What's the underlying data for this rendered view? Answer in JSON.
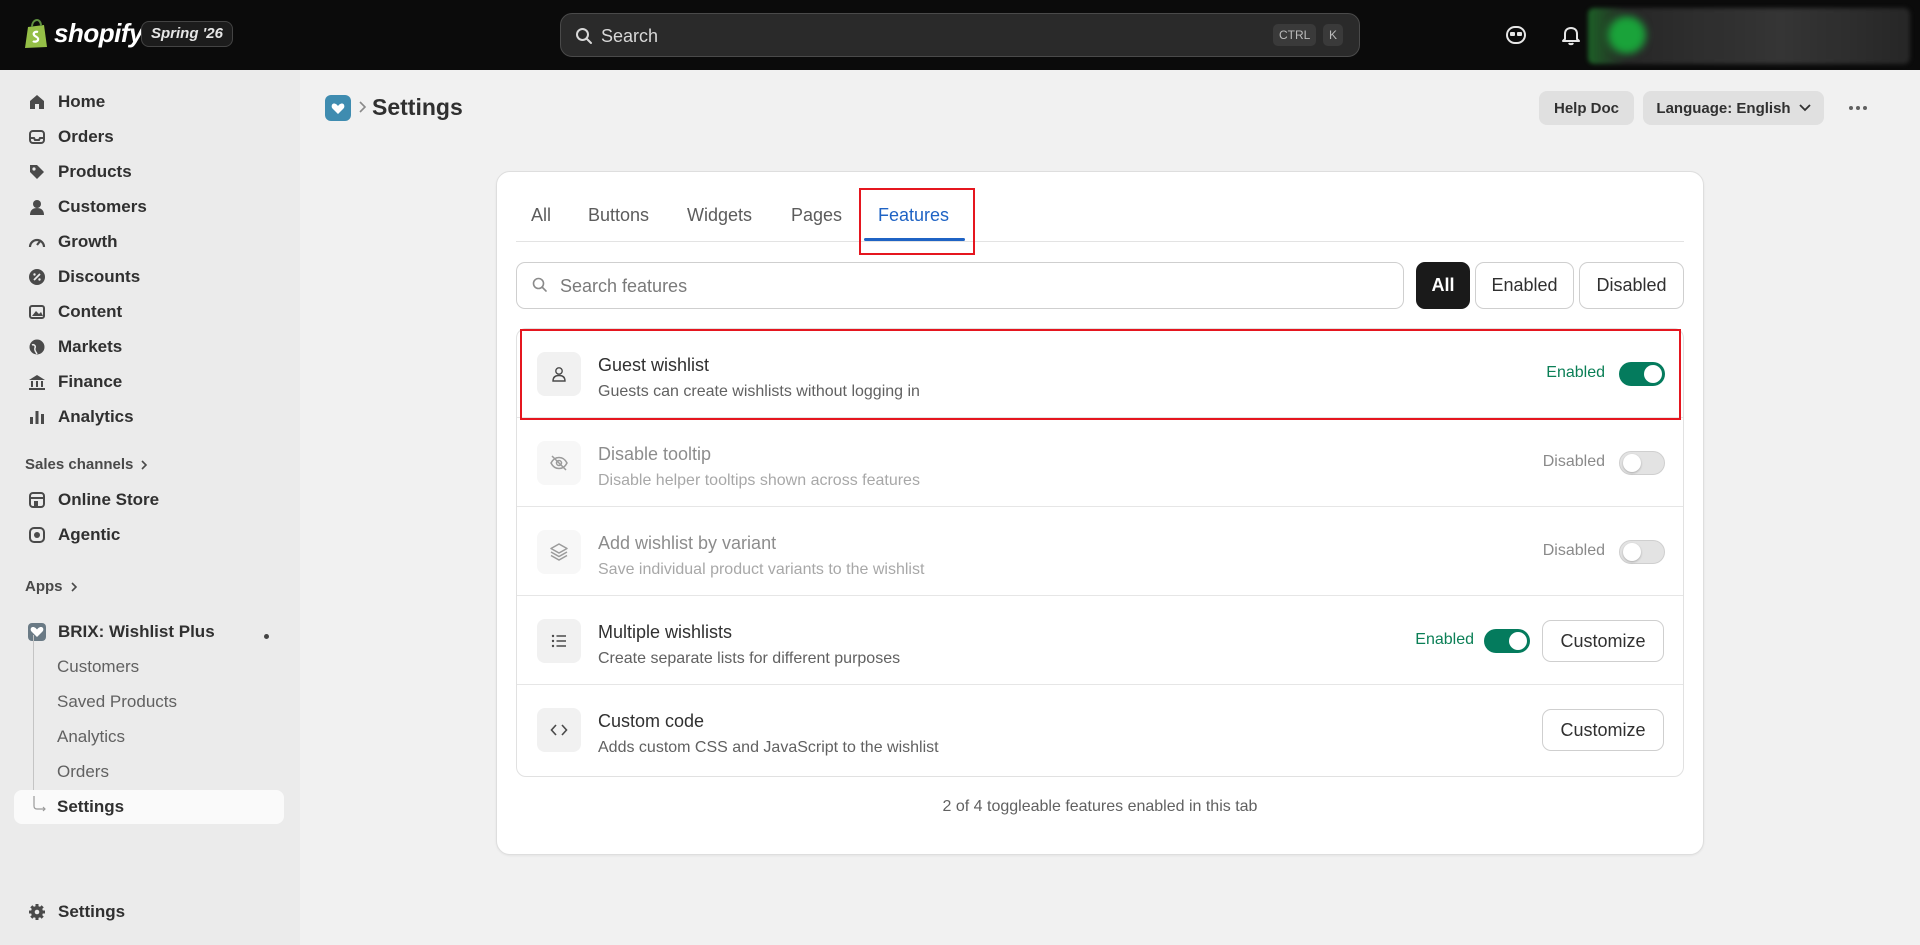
{
  "topbar": {
    "logo_text": "shopify",
    "edition_badge": "Spring '26",
    "search_placeholder": "Search",
    "shortcut_ctrl": "CTRL",
    "shortcut_key": "K"
  },
  "sidebar": {
    "items": [
      {
        "label": "Home",
        "icon": "home-icon"
      },
      {
        "label": "Orders",
        "icon": "orders-icon"
      },
      {
        "label": "Products",
        "icon": "tag-icon"
      },
      {
        "label": "Customers",
        "icon": "person-icon"
      },
      {
        "label": "Growth",
        "icon": "gauge-icon"
      },
      {
        "label": "Discounts",
        "icon": "discount-icon"
      },
      {
        "label": "Content",
        "icon": "image-icon"
      },
      {
        "label": "Markets",
        "icon": "globe-icon"
      },
      {
        "label": "Finance",
        "icon": "bank-icon"
      },
      {
        "label": "Analytics",
        "icon": "bar-chart-icon"
      }
    ],
    "sales_channels_label": "Sales channels",
    "channels": [
      {
        "label": "Online Store",
        "icon": "store-icon"
      },
      {
        "label": "Agentic",
        "icon": "agentic-icon"
      }
    ],
    "apps_label": "Apps",
    "app": {
      "label": "BRIX: Wishlist Plus",
      "icon": "wishlist-app-icon"
    },
    "app_subitems": [
      "Customers",
      "Saved Products",
      "Analytics",
      "Orders",
      "Settings"
    ],
    "bottom_settings": "Settings"
  },
  "header": {
    "title": "Settings",
    "help_doc": "Help Doc",
    "language": "Language: English"
  },
  "tabs": [
    "All",
    "Buttons",
    "Widgets",
    "Pages",
    "Features"
  ],
  "active_tab": "Features",
  "search": {
    "placeholder": "Search features"
  },
  "filters": [
    "All",
    "Enabled",
    "Disabled"
  ],
  "features": [
    {
      "title": "Guest wishlist",
      "desc": "Guests can create wishlists without logging in",
      "status": "Enabled",
      "enabled": true,
      "icon": "person-icon"
    },
    {
      "title": "Disable tooltip",
      "desc": "Disable helper tooltips shown across features",
      "status": "Disabled",
      "enabled": false,
      "icon": "eye-off-icon"
    },
    {
      "title": "Add wishlist by variant",
      "desc": "Save individual product variants to the wishlist",
      "status": "Disabled",
      "enabled": false,
      "icon": "layers-icon"
    },
    {
      "title": "Multiple wishlists",
      "desc": "Create separate lists for different purposes",
      "status": "Enabled",
      "enabled": true,
      "icon": "list-icon",
      "button": "Customize"
    },
    {
      "title": "Custom code",
      "desc": "Adds custom CSS and JavaScript to the wishlist",
      "icon": "code-icon",
      "button": "Customize"
    }
  ],
  "footer_note": "2 of 4 toggleable features enabled in this tab",
  "colors": {
    "accent_blue": "#1f63c4",
    "enabled_green": "#047b5d",
    "highlight_red": "#e5161f"
  }
}
